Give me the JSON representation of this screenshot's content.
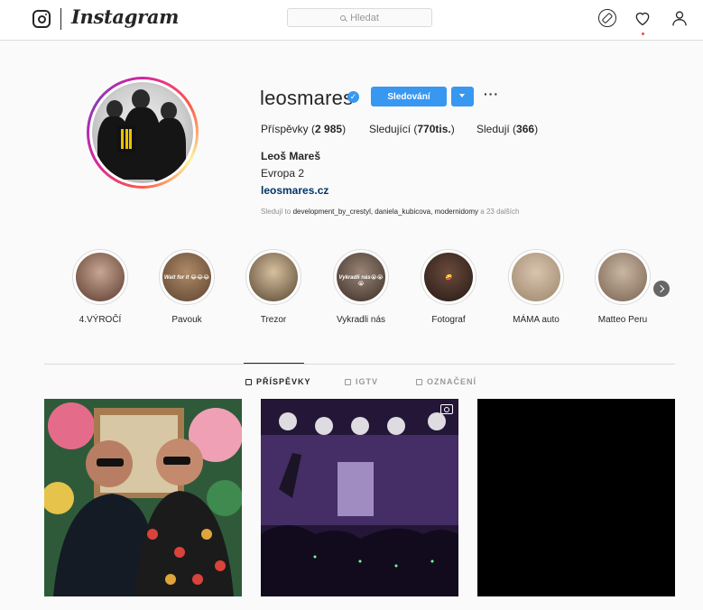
{
  "nav": {
    "wordmark": "Instagram",
    "search_placeholder": "Hledat"
  },
  "profile": {
    "username": "leosmares",
    "verified_mark": "✓",
    "follow_button": "Sledování",
    "more": "···",
    "stats": {
      "posts_label": "Příspěvky",
      "posts_count": "2 985",
      "followers_label": "Sledující",
      "followers_count": "770tis.",
      "following_label": "Sledují",
      "following_count": "366"
    },
    "full_name": "Leoš Mareš",
    "bio": "Evropa 2",
    "website": "leosmares.cz",
    "followed_by": {
      "prefix": "Sledují to",
      "users": "development_by_crestyl, daniela_kubicova, modernidomy",
      "suffix": "a 23 dalších"
    }
  },
  "highlights": [
    {
      "label": "4.VÝROČÍ",
      "color_a": "#c7a693",
      "color_b": "#5a3a2e"
    },
    {
      "label": "Pavouk",
      "color_a": "#b08a66",
      "color_b": "#5b4330",
      "overlay": "Wait for it 😂😂😂"
    },
    {
      "label": "Trezor",
      "color_a": "#d8c0a0",
      "color_b": "#55452f"
    },
    {
      "label": "Vykradli nás",
      "color_a": "#9a8576",
      "color_b": "#3a2d25",
      "overlay": "Vykradli nás😭😭😭"
    },
    {
      "label": "Fotograf",
      "color_a": "#6b4a3c",
      "color_b": "#241915",
      "overlay": "🤪"
    },
    {
      "label": "MÁMA auto",
      "color_a": "#d9c4b0",
      "color_b": "#9b8569"
    },
    {
      "label": "Matteo Peru",
      "color_a": "#c9b7a3",
      "color_b": "#7a6150"
    }
  ],
  "tabs": [
    {
      "label": "PŘÍSPĚVKY",
      "active": true
    },
    {
      "label": "IGTV",
      "active": false
    },
    {
      "label": "OZNAČENÍ",
      "active": false
    }
  ]
}
